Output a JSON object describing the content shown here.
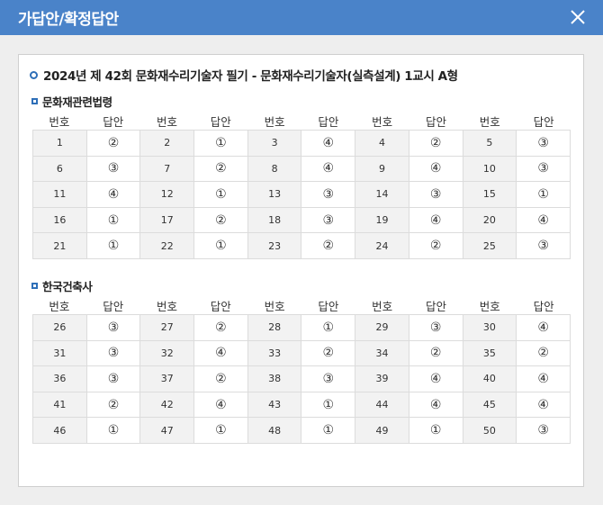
{
  "dialog": {
    "title": "가답안/확정답안"
  },
  "exam": {
    "title": "2024년 제 42회 문화재수리기술자 필기 - 문화재수리기술자(실측설계) 1교시 A형"
  },
  "headers": {
    "num": "번호",
    "ans": "답안"
  },
  "sections": [
    {
      "name": "문화재관련법령",
      "rows": [
        [
          [
            "1",
            "②"
          ],
          [
            "2",
            "①"
          ],
          [
            "3",
            "④"
          ],
          [
            "4",
            "②"
          ],
          [
            "5",
            "③"
          ]
        ],
        [
          [
            "6",
            "③"
          ],
          [
            "7",
            "②"
          ],
          [
            "8",
            "④"
          ],
          [
            "9",
            "④"
          ],
          [
            "10",
            "③"
          ]
        ],
        [
          [
            "11",
            "④"
          ],
          [
            "12",
            "①"
          ],
          [
            "13",
            "③"
          ],
          [
            "14",
            "③"
          ],
          [
            "15",
            "①"
          ]
        ],
        [
          [
            "16",
            "①"
          ],
          [
            "17",
            "②"
          ],
          [
            "18",
            "③"
          ],
          [
            "19",
            "④"
          ],
          [
            "20",
            "④"
          ]
        ],
        [
          [
            "21",
            "①"
          ],
          [
            "22",
            "①"
          ],
          [
            "23",
            "②"
          ],
          [
            "24",
            "②"
          ],
          [
            "25",
            "③"
          ]
        ]
      ]
    },
    {
      "name": "한국건축사",
      "rows": [
        [
          [
            "26",
            "③"
          ],
          [
            "27",
            "②"
          ],
          [
            "28",
            "①"
          ],
          [
            "29",
            "③"
          ],
          [
            "30",
            "④"
          ]
        ],
        [
          [
            "31",
            "③"
          ],
          [
            "32",
            "④"
          ],
          [
            "33",
            "②"
          ],
          [
            "34",
            "②"
          ],
          [
            "35",
            "②"
          ]
        ],
        [
          [
            "36",
            "③"
          ],
          [
            "37",
            "②"
          ],
          [
            "38",
            "③"
          ],
          [
            "39",
            "④"
          ],
          [
            "40",
            "④"
          ]
        ],
        [
          [
            "41",
            "②"
          ],
          [
            "42",
            "④"
          ],
          [
            "43",
            "①"
          ],
          [
            "44",
            "④"
          ],
          [
            "45",
            "④"
          ]
        ],
        [
          [
            "46",
            "①"
          ],
          [
            "47",
            "①"
          ],
          [
            "48",
            "①"
          ],
          [
            "49",
            "①"
          ],
          [
            "50",
            "③"
          ]
        ]
      ]
    }
  ]
}
